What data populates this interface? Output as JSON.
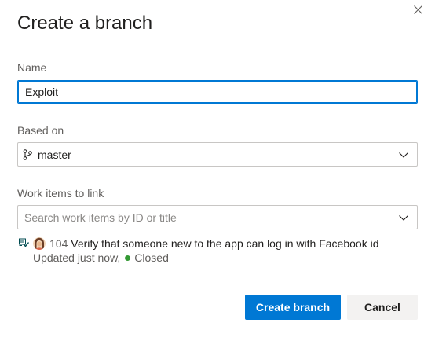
{
  "dialog": {
    "title": "Create a branch",
    "close_icon": "close-icon"
  },
  "name_field": {
    "label": "Name",
    "value": "Exploit"
  },
  "based_on": {
    "label": "Based on",
    "value": "master",
    "icon": "branch-icon"
  },
  "work_items": {
    "label": "Work items to link",
    "placeholder": "Search work items by ID or title",
    "items": [
      {
        "id": "104",
        "title": "Verify that someone new to the app can log in with Facebook id",
        "updated": "Updated just now,",
        "state": "Closed",
        "state_color": "#339933",
        "type_icon": "test-case-icon"
      }
    ]
  },
  "actions": {
    "primary_label": "Create branch",
    "secondary_label": "Cancel"
  },
  "colors": {
    "accent": "#0078d4",
    "text": "#201f1e",
    "secondary_text": "#605e5c"
  }
}
